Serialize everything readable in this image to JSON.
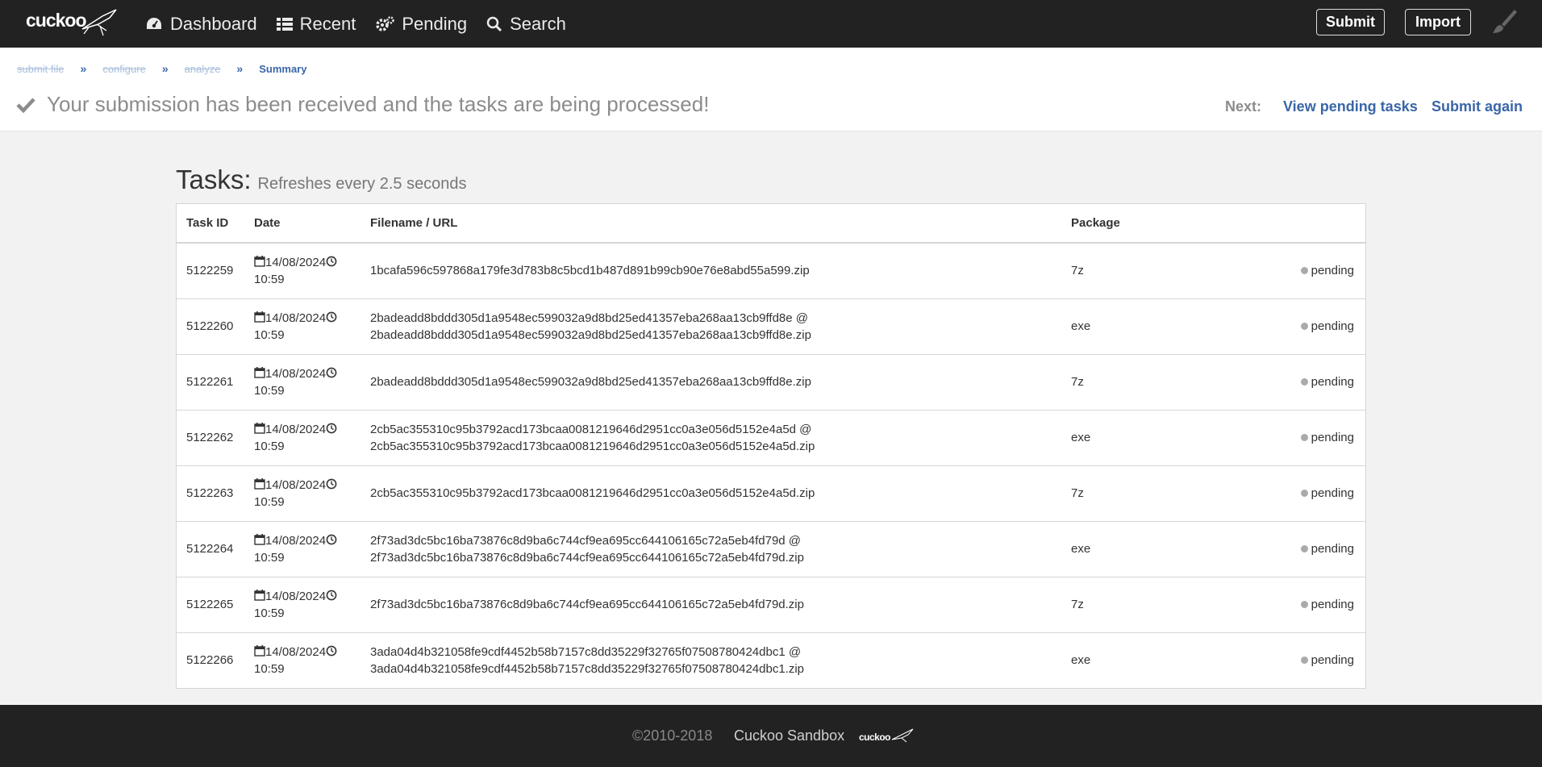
{
  "nav": {
    "logo_text": "cuckoo",
    "items": [
      {
        "label": "Dashboard",
        "icon": "dashboard-icon"
      },
      {
        "label": "Recent",
        "icon": "list-icon"
      },
      {
        "label": "Pending",
        "icon": "cogs-icon"
      },
      {
        "label": "Search",
        "icon": "search-icon"
      }
    ],
    "submit_label": "Submit",
    "import_label": "Import",
    "theme_icon": "paintbrush-icon"
  },
  "breadcrumb": {
    "steps": [
      "submit file",
      "configure",
      "analyze"
    ],
    "current": "Summary"
  },
  "flash": {
    "message": "Your submission has been received and the tasks are being processed!",
    "next_label": "Next:",
    "view_pending": "View pending tasks",
    "submit_again": "Submit again"
  },
  "tasks": {
    "title": "Tasks:",
    "subtitle": "Refreshes every 2.5 seconds",
    "columns": [
      "Task ID",
      "Date",
      "Filename / URL",
      "Package",
      ""
    ],
    "rows": [
      {
        "id": "5122259",
        "date": "14/08/2024",
        "time": "10:59",
        "file1": "1bcafa596c597868a179fe3d783b8c5bcd1b487d891b99cb90e76e8abd55a599.zip",
        "file2": "",
        "package": "7z",
        "status": "pending"
      },
      {
        "id": "5122260",
        "date": "14/08/2024",
        "time": "10:59",
        "file1": "2badeadd8bddd305d1a9548ec599032a9d8bd25ed41357eba268aa13cb9ffd8e @",
        "file2": "2badeadd8bddd305d1a9548ec599032a9d8bd25ed41357eba268aa13cb9ffd8e.zip",
        "package": "exe",
        "status": "pending"
      },
      {
        "id": "5122261",
        "date": "14/08/2024",
        "time": "10:59",
        "file1": "2badeadd8bddd305d1a9548ec599032a9d8bd25ed41357eba268aa13cb9ffd8e.zip",
        "file2": "",
        "package": "7z",
        "status": "pending"
      },
      {
        "id": "5122262",
        "date": "14/08/2024",
        "time": "10:59",
        "file1": "2cb5ac355310c95b3792acd173bcaa0081219646d2951cc0a3e056d5152e4a5d @",
        "file2": "2cb5ac355310c95b3792acd173bcaa0081219646d2951cc0a3e056d5152e4a5d.zip",
        "package": "exe",
        "status": "pending"
      },
      {
        "id": "5122263",
        "date": "14/08/2024",
        "time": "10:59",
        "file1": "2cb5ac355310c95b3792acd173bcaa0081219646d2951cc0a3e056d5152e4a5d.zip",
        "file2": "",
        "package": "7z",
        "status": "pending"
      },
      {
        "id": "5122264",
        "date": "14/08/2024",
        "time": "10:59",
        "file1": "2f73ad3dc5bc16ba73876c8d9ba6c744cf9ea695cc644106165c72a5eb4fd79d @",
        "file2": "2f73ad3dc5bc16ba73876c8d9ba6c744cf9ea695cc644106165c72a5eb4fd79d.zip",
        "package": "exe",
        "status": "pending"
      },
      {
        "id": "5122265",
        "date": "14/08/2024",
        "time": "10:59",
        "file1": "2f73ad3dc5bc16ba73876c8d9ba6c744cf9ea695cc644106165c72a5eb4fd79d.zip",
        "file2": "",
        "package": "7z",
        "status": "pending"
      },
      {
        "id": "5122266",
        "date": "14/08/2024",
        "time": "10:59",
        "file1": "3ada04d4b321058fe9cdf4452b58b7157c8dd35229f32765f07508780424dbc1 @",
        "file2": "3ada04d4b321058fe9cdf4452b58b7157c8dd35229f32765f07508780424dbc1.zip",
        "package": "exe",
        "status": "pending"
      }
    ]
  },
  "footer": {
    "copyright": "©2010-2018",
    "name": "Cuckoo Sandbox",
    "logo_text": "cuckoo"
  }
}
